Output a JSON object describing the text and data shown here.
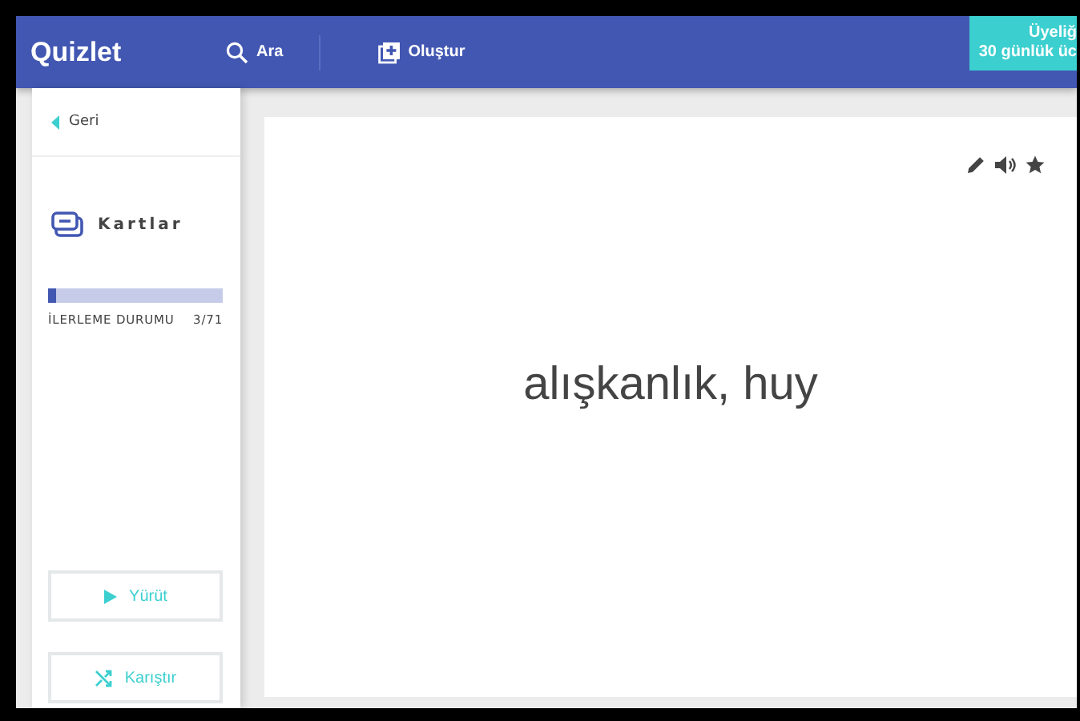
{
  "header": {
    "logo": "Quizlet",
    "search_label": "Ara",
    "create_label": "Oluştur",
    "upgrade_lines": [
      "Üyeliğ",
      "30 günlük üc"
    ]
  },
  "sidebar": {
    "back": "Geri",
    "mode": "Kartlar",
    "progress": {
      "level": 0.042,
      "label": "İLERLEME DURUMU",
      "count": "3/71"
    },
    "buttons": [
      {
        "kind": "play",
        "label": "Yürüt"
      },
      {
        "kind": "shuffle",
        "label": "Karıştır"
      }
    ]
  },
  "card": {
    "term": "alışkanlık, huy",
    "starred": false
  }
}
